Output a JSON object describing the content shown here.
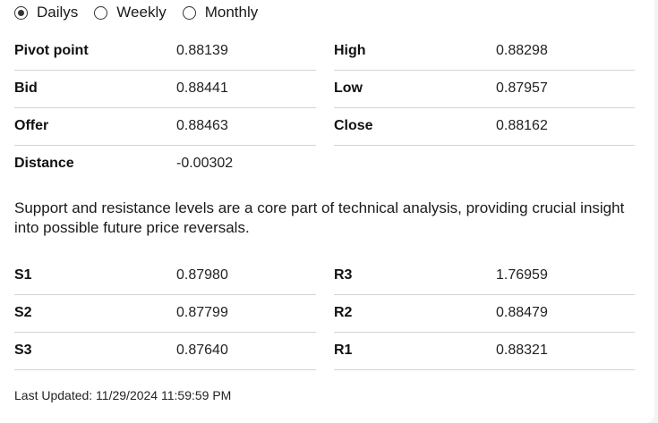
{
  "timeframe": {
    "options": [
      "Dailys",
      "Weekly",
      "Monthly"
    ],
    "selected": "Dailys"
  },
  "pivot_table": {
    "left": [
      {
        "label": "Pivot point",
        "value": "0.88139"
      },
      {
        "label": "Bid",
        "value": "0.88441"
      },
      {
        "label": "Offer",
        "value": "0.88463"
      },
      {
        "label": "Distance",
        "value": "-0.00302"
      }
    ],
    "right": [
      {
        "label": "High",
        "value": "0.88298"
      },
      {
        "label": "Low",
        "value": "0.87957"
      },
      {
        "label": "Close",
        "value": "0.88162"
      }
    ]
  },
  "description": "Support and resistance levels are a core part of technical analysis, providing crucial insight into possible future price reversals.",
  "levels_table": {
    "left": [
      {
        "label": "S1",
        "value": "0.87980"
      },
      {
        "label": "S2",
        "value": "0.87799"
      },
      {
        "label": "S3",
        "value": "0.87640"
      }
    ],
    "right": [
      {
        "label": "R3",
        "value": "1.76959"
      },
      {
        "label": "R2",
        "value": "0.88479"
      },
      {
        "label": "R1",
        "value": "0.88321"
      }
    ]
  },
  "last_updated": "Last Updated: 11/29/2024 11:59:59 PM"
}
